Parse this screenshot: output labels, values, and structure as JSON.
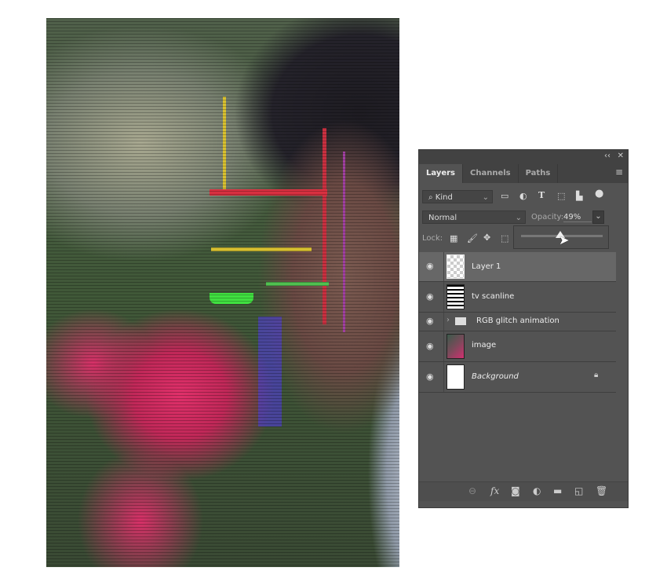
{
  "panel": {
    "tabs": [
      {
        "label": "Layers"
      },
      {
        "label": "Channels"
      },
      {
        "label": "Paths"
      }
    ],
    "filter": {
      "label": "Kind"
    },
    "blend_mode": "Normal",
    "opacity_label": "Opacity:",
    "opacity_value": "49%",
    "opacity_slider_fraction": 0.49,
    "lock_label": "Lock:",
    "layers": [
      {
        "name": "Layer 1",
        "active": true
      },
      {
        "name": "tv scanline"
      },
      {
        "name": "RGB glitch animation",
        "type": "group"
      },
      {
        "name": "image"
      },
      {
        "name": "Background",
        "locked": true
      }
    ],
    "icons": {
      "collapse": "‹‹",
      "close": "✕",
      "menu": "≡",
      "search": "⌕",
      "eye": "👁",
      "lock": "🔒",
      "fx": "fx"
    }
  }
}
